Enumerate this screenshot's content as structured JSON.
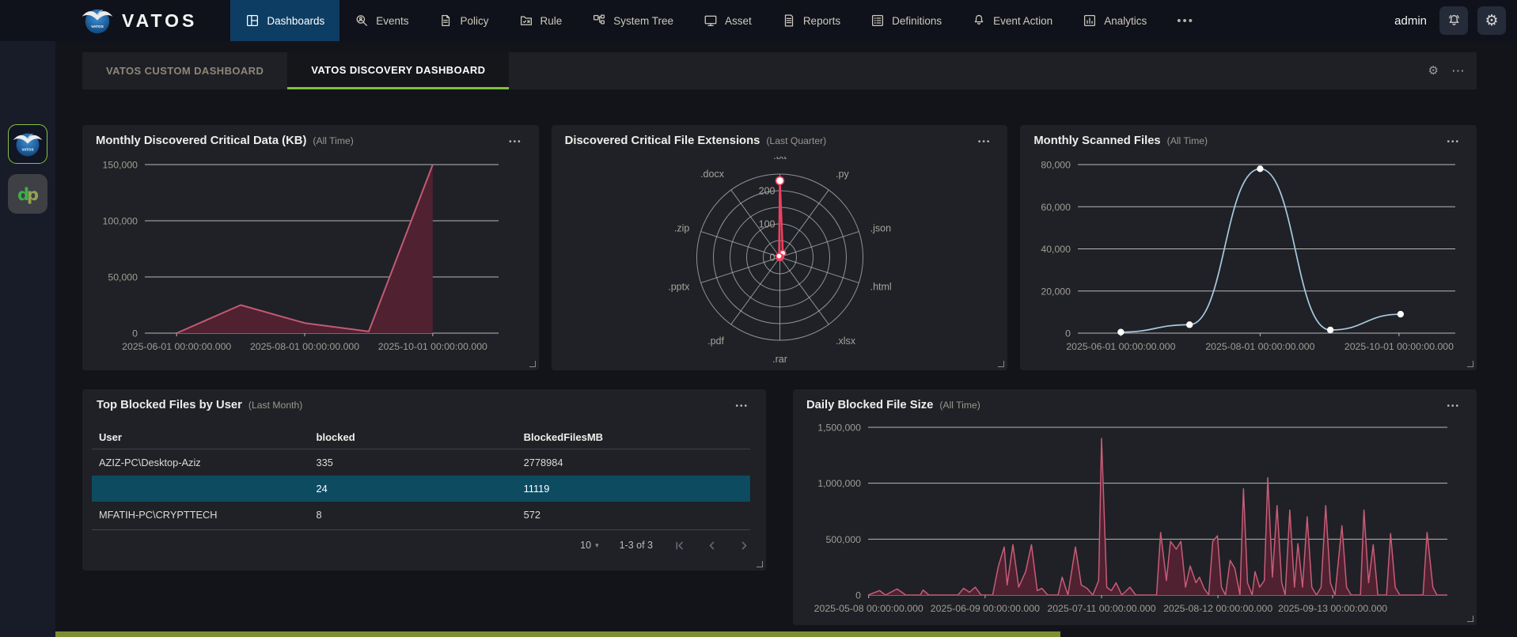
{
  "navbar": {
    "brand": "VATOS",
    "items": [
      {
        "label": "Dashboards",
        "icon": "dashboard-icon",
        "active": true
      },
      {
        "label": "Events",
        "icon": "search-user-icon",
        "active": false
      },
      {
        "label": "Policy",
        "icon": "policy-document-icon",
        "active": false
      },
      {
        "label": "Rule",
        "icon": "rule-folder-icon",
        "active": false
      },
      {
        "label": "System Tree",
        "icon": "system-tree-icon",
        "active": false
      },
      {
        "label": "Asset",
        "icon": "monitor-icon",
        "active": false
      },
      {
        "label": "Reports",
        "icon": "report-document-icon",
        "active": false
      },
      {
        "label": "Definitions",
        "icon": "definitions-list-icon",
        "active": false
      },
      {
        "label": "Event Action",
        "icon": "bell-icon",
        "active": false
      },
      {
        "label": "Analytics",
        "icon": "analytics-chart-icon",
        "active": false
      }
    ],
    "overflow": "•••",
    "user": "admin"
  },
  "sidebar": {
    "apps": [
      {
        "name": "vatos-app",
        "active": true
      },
      {
        "name": "dp-app",
        "active": false
      }
    ]
  },
  "tabs": [
    {
      "label": "VATOS CUSTOM DASHBOARD",
      "active": false
    },
    {
      "label": "VATOS DISCOVERY DASHBOARD",
      "active": true
    }
  ],
  "icons": {
    "card_menu": "•••",
    "tab_gear": "⚙",
    "tab_overflow": "⋯",
    "page_size_caret": "▾"
  },
  "colors": {
    "accent_green": "#7fc03d",
    "active_nav_blue": "#0d3d63",
    "highlight_row_teal": "#0d4b61",
    "chart_red_line": "#c25a74",
    "chart_red_fill": "#4f2131",
    "radar_red": "#f43f5e",
    "chart_blue_line": "#a9c9df",
    "bottom_bar_olive": "#7d8e33"
  },
  "chart_data": [
    {
      "id": "monthly_discovered",
      "type": "area",
      "title": "Monthly Discovered Critical Data (KB)",
      "subtitle": "(All Time)",
      "xlabel": "",
      "ylabel": "",
      "ylim": [
        0,
        150000
      ],
      "grid": true,
      "yticks": [
        {
          "v": 0,
          "label": "0"
        },
        {
          "v": 50000,
          "label": "50,000"
        },
        {
          "v": 100000,
          "label": "100,000"
        },
        {
          "v": 150000,
          "label": "150,000"
        }
      ],
      "xticks": [
        {
          "f": 0.09,
          "label": "2025-06-01 00:00:00.000"
        },
        {
          "f": 0.452,
          "label": "2025-08-01 00:00:00.000"
        },
        {
          "f": 0.814,
          "label": "2025-10-01 00:00:00.000"
        }
      ],
      "x_dates": [
        "2025-06-01",
        "2025-07-01",
        "2025-08-01",
        "2025-09-01",
        "2025-10-01"
      ],
      "values": [
        0,
        25000,
        9000,
        1500,
        150000
      ],
      "points": [
        [
          0.09,
          0
        ],
        [
          0.271,
          25000
        ],
        [
          0.452,
          9000
        ],
        [
          0.633,
          1500
        ],
        [
          0.814,
          150000
        ]
      ],
      "line_color": "#c25a74",
      "fill_color": "#4f2131",
      "ml": 62,
      "mr": 34,
      "mt": 10,
      "mb": 47,
      "lw": 2
    },
    {
      "id": "file_extensions",
      "type": "radar",
      "title": "Discovered Critical File Extensions",
      "subtitle": "(Last Quarter)",
      "categories": [
        ".txt",
        ".py",
        ".json",
        ".html",
        ".xlsx",
        ".rar",
        ".pdf",
        ".pptx",
        ".zip",
        ".docx"
      ],
      "values": [
        230,
        15,
        3,
        2,
        2,
        2,
        2,
        2,
        2,
        4
      ],
      "rmax": 250,
      "rings": 5,
      "rticks": [
        {
          "v": 0,
          "label": "0"
        },
        {
          "v": 100,
          "label": "100"
        },
        {
          "v": 200,
          "label": "200"
        }
      ],
      "line_color": "#f43f5e"
    },
    {
      "id": "monthly_scanned",
      "type": "line",
      "title": "Monthly Scanned Files",
      "subtitle": "(All Time)",
      "xlabel": "",
      "ylabel": "",
      "ylim": [
        0,
        80000
      ],
      "grid": true,
      "yticks": [
        {
          "v": 0,
          "label": "0"
        },
        {
          "v": 20000,
          "label": "20,000"
        },
        {
          "v": 40000,
          "label": "40,000"
        },
        {
          "v": 60000,
          "label": "60,000"
        },
        {
          "v": 80000,
          "label": "80,000"
        }
      ],
      "xticks": [
        {
          "f": 0.114,
          "label": "2025-06-01 00:00:00.000"
        },
        {
          "f": 0.483,
          "label": "2025-08-01 00:00:00.000"
        },
        {
          "f": 0.851,
          "label": "2025-10-01 00:00:00.000"
        }
      ],
      "x_dates": [
        "2025-06-01",
        "2025-07-01",
        "2025-08-01",
        "2025-09-01",
        "2025-10-01"
      ],
      "values": [
        500,
        4000,
        78000,
        1500,
        9000
      ],
      "points": [
        [
          0.114,
          500
        ],
        [
          0.296,
          4000
        ],
        [
          0.483,
          78000
        ],
        [
          0.669,
          1500
        ],
        [
          0.855,
          9000
        ]
      ],
      "line_color": "#a9c9df",
      "smooth": true,
      "dots": true,
      "ml": 56,
      "mr": 10,
      "mt": 10,
      "mb": 47,
      "lw": 1.7
    },
    {
      "id": "top_blocked",
      "type": "table",
      "title": "Top Blocked Files by User",
      "subtitle": "(Last Month)",
      "columns": [
        "User",
        "blocked",
        "BlockedFilesMB"
      ],
      "rows": [
        [
          "AZIZ-PC\\Desktop-Aziz",
          "335",
          "2778984"
        ],
        [
          "",
          "24",
          "11119"
        ],
        [
          "MFATIH-PC\\CRYPTTECH",
          "8",
          "572"
        ]
      ],
      "highlighted_row": 1,
      "pagination": {
        "page_size": "10",
        "range": "1-3 of 3"
      }
    },
    {
      "id": "daily_blocked",
      "type": "area",
      "title": "Daily Blocked File Size",
      "subtitle": "(All Time)",
      "xlabel": "",
      "ylabel": "",
      "ylim": [
        0,
        1500000
      ],
      "grid": true,
      "yticks": [
        {
          "v": 0,
          "label": "0"
        },
        {
          "v": 500000,
          "label": "500,000"
        },
        {
          "v": 1000000,
          "label": "1,000,000"
        },
        {
          "v": 1500000,
          "label": "1,500,000"
        }
      ],
      "xticks": [
        {
          "f": 0.001,
          "label": "2025-05-08 00:00:00.000"
        },
        {
          "f": 0.202,
          "label": "2025-06-09 00:00:00.000"
        },
        {
          "f": 0.403,
          "label": "2025-07-11 00:00:00.000"
        },
        {
          "f": 0.604,
          "label": "2025-08-12 00:00:00.000"
        },
        {
          "f": 0.802,
          "label": "2025-09-13 00:00:00.000"
        }
      ],
      "points": [
        [
          0,
          0
        ],
        [
          0.02,
          40000
        ],
        [
          0.03,
          0
        ],
        [
          0.05,
          55000
        ],
        [
          0.065,
          0
        ],
        [
          0.09,
          0
        ],
        [
          0.095,
          45000
        ],
        [
          0.105,
          0
        ],
        [
          0.155,
          0
        ],
        [
          0.165,
          60000
        ],
        [
          0.175,
          25000
        ],
        [
          0.185,
          70000
        ],
        [
          0.195,
          0
        ],
        [
          0.215,
          0
        ],
        [
          0.225,
          260000
        ],
        [
          0.235,
          430000
        ],
        [
          0.24,
          90000
        ],
        [
          0.25,
          450000
        ],
        [
          0.26,
          70000
        ],
        [
          0.272,
          210000
        ],
        [
          0.282,
          450000
        ],
        [
          0.292,
          40000
        ],
        [
          0.3,
          60000
        ],
        [
          0.31,
          0
        ],
        [
          0.328,
          0
        ],
        [
          0.335,
          160000
        ],
        [
          0.345,
          0
        ],
        [
          0.358,
          430000
        ],
        [
          0.368,
          90000
        ],
        [
          0.378,
          60000
        ],
        [
          0.388,
          0
        ],
        [
          0.398,
          130000
        ],
        [
          0.403,
          1400000
        ],
        [
          0.412,
          70000
        ],
        [
          0.42,
          40000
        ],
        [
          0.428,
          110000
        ],
        [
          0.438,
          0
        ],
        [
          0.452,
          70000
        ],
        [
          0.462,
          0
        ],
        [
          0.498,
          0
        ],
        [
          0.505,
          560000
        ],
        [
          0.515,
          130000
        ],
        [
          0.522,
          480000
        ],
        [
          0.532,
          410000
        ],
        [
          0.54,
          480000
        ],
        [
          0.548,
          70000
        ],
        [
          0.556,
          260000
        ],
        [
          0.566,
          110000
        ],
        [
          0.572,
          160000
        ],
        [
          0.58,
          60000
        ],
        [
          0.588,
          0
        ],
        [
          0.595,
          480000
        ],
        [
          0.603,
          530000
        ],
        [
          0.61,
          70000
        ],
        [
          0.617,
          0
        ],
        [
          0.625,
          310000
        ],
        [
          0.633,
          240000
        ],
        [
          0.642,
          0
        ],
        [
          0.648,
          950000
        ],
        [
          0.655,
          110000
        ],
        [
          0.663,
          0
        ],
        [
          0.668,
          210000
        ],
        [
          0.676,
          70000
        ],
        [
          0.684,
          130000
        ],
        [
          0.69,
          1050000
        ],
        [
          0.698,
          160000
        ],
        [
          0.706,
          800000
        ],
        [
          0.714,
          110000
        ],
        [
          0.72,
          0
        ],
        [
          0.728,
          760000
        ],
        [
          0.736,
          70000
        ],
        [
          0.742,
          460000
        ],
        [
          0.75,
          70000
        ],
        [
          0.758,
          700000
        ],
        [
          0.766,
          70000
        ],
        [
          0.774,
          0
        ],
        [
          0.782,
          70000
        ],
        [
          0.79,
          800000
        ],
        [
          0.798,
          110000
        ],
        [
          0.806,
          0
        ],
        [
          0.818,
          620000
        ],
        [
          0.826,
          70000
        ],
        [
          0.834,
          0
        ],
        [
          0.85,
          0
        ],
        [
          0.856,
          760000
        ],
        [
          0.864,
          110000
        ],
        [
          0.872,
          450000
        ],
        [
          0.88,
          0
        ],
        [
          0.895,
          0
        ],
        [
          0.902,
          550000
        ],
        [
          0.91,
          70000
        ],
        [
          0.918,
          0
        ],
        [
          0.958,
          0
        ],
        [
          0.965,
          560000
        ],
        [
          0.975,
          70000
        ],
        [
          0.982,
          0
        ],
        [
          1,
          0
        ]
      ],
      "line_color": "#c75d77",
      "fill_color": "#4f2131",
      "ml": 78,
      "mr": 20,
      "mt": 8,
      "mb": 38,
      "lw": 1.5
    }
  ]
}
